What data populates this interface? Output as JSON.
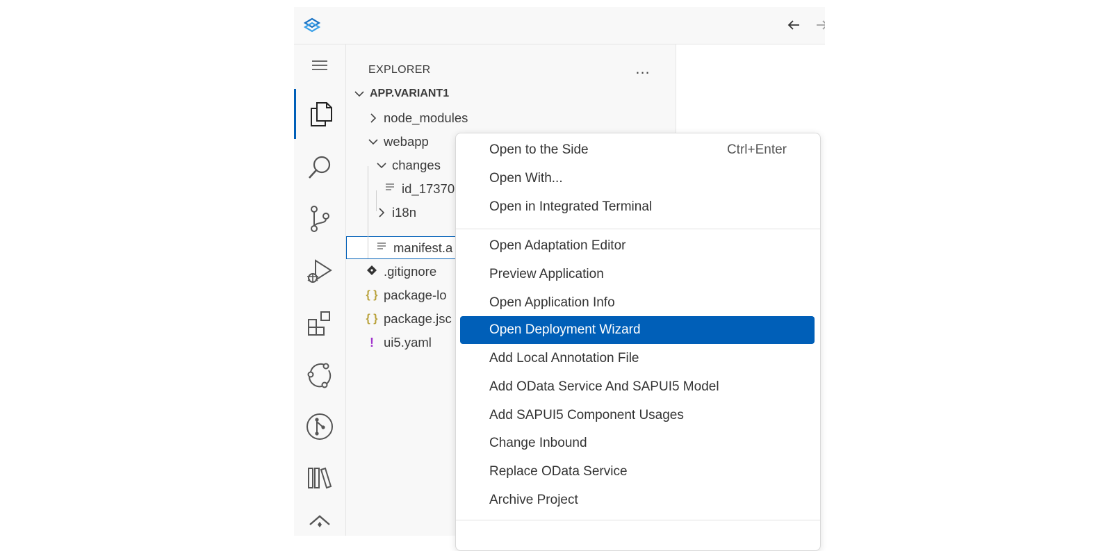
{
  "window": {
    "logo_icon": "sap-bas-logo-icon",
    "nav": {
      "back_icon": "arrow-left-icon",
      "forward_icon": "arrow-right-icon"
    }
  },
  "activity_bar": {
    "items": [
      {
        "name": "menu-icon",
        "active": false
      },
      {
        "name": "files-icon",
        "active": true
      },
      {
        "name": "search-icon",
        "active": false
      },
      {
        "name": "source-control-icon",
        "active": false
      },
      {
        "name": "run-debug-icon",
        "active": false
      },
      {
        "name": "extensions-icon",
        "active": false
      },
      {
        "name": "remote-icon",
        "active": false
      },
      {
        "name": "git-graph-icon",
        "active": false
      },
      {
        "name": "library-icon",
        "active": false
      },
      {
        "name": "sap-ai-icon",
        "active": false
      }
    ]
  },
  "explorer": {
    "title": "EXPLORER",
    "more": "...",
    "root": "APP.VARIANT1",
    "items": {
      "node_modules": "node_modules",
      "webapp": "webapp",
      "changes": "changes",
      "id_file": "id_17370",
      "i18n": "i18n",
      "manifest": "manifest.a",
      "gitignore": ".gitignore",
      "package_lock": "package-lo",
      "package_json": "package.jsc",
      "ui5yaml": "ui5.yaml"
    },
    "glyphs": {
      "json": "{ }",
      "yaml": "!"
    }
  },
  "context_menu": {
    "group1": [
      {
        "label": "Open to the Side",
        "shortcut": "Ctrl+Enter"
      },
      {
        "label": "Open With..."
      },
      {
        "label": "Open in Integrated Terminal"
      }
    ],
    "group2": [
      {
        "label": "Open Adaptation Editor"
      },
      {
        "label": "Preview Application"
      },
      {
        "label": "Open Application Info"
      },
      {
        "label": "Open Deployment Wizard",
        "highlighted": true
      },
      {
        "label": "Add Local Annotation File"
      },
      {
        "label": "Add OData Service And SAPUI5 Model"
      },
      {
        "label": "Add SAPUI5 Component Usages"
      },
      {
        "label": "Change Inbound"
      },
      {
        "label": "Replace OData Service"
      },
      {
        "label": "Archive Project"
      }
    ]
  },
  "colors": {
    "accent": "#005fb8",
    "json_icon": "#b8a13a",
    "yaml_icon": "#a033cc",
    "git_icon": "#333333"
  }
}
